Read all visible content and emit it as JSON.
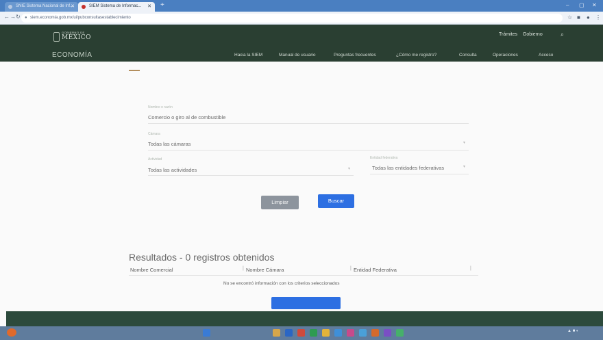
{
  "browser": {
    "tabs": [
      {
        "label": "SNIE Sistema Nacional de Inf...",
        "active": false
      },
      {
        "label": "SIEM Sistema de Informac...",
        "active": true
      }
    ],
    "url": "siem.economia.gob.mx/ui/pubconsultasestablecimiento",
    "new_tab_icon": "plus-icon",
    "window_controls": [
      "minimize-icon",
      "maximize-icon",
      "close-icon"
    ]
  },
  "header": {
    "logo_small": "GOBIERNO DE",
    "logo_big": "MÉXICO",
    "section": "ECONOMÍA",
    "top_links": [
      "Trámites",
      "Gobierno"
    ],
    "search_icon": "search-icon",
    "menu": [
      "Hacia la SIEM",
      "Manual de usuario",
      "Preguntas frecuentes",
      "¿Cómo me registro?",
      "Consulta",
      "Operaciones",
      "Acceso"
    ]
  },
  "form": {
    "field1": {
      "label": "Nombre o razón",
      "value": "Comercio o giro al de combustible"
    },
    "field2": {
      "label": "Cámara",
      "value": "Todas las cámaras"
    },
    "field3": {
      "label": "Actividad",
      "value": "Todas las actividades"
    },
    "field4": {
      "label": "Entidad federativa",
      "value": "Todas las entidades federativas"
    },
    "clear_label": "Limpiar",
    "search_label": "Buscar"
  },
  "results": {
    "title": "Resultados - 0 registros obtenidos",
    "columns": [
      "Nombre Comercial",
      "Nombre Cámara",
      "Entidad Federativa"
    ],
    "empty_message": "No se encontró información con los criterios seleccionados",
    "count": 0
  },
  "colors": {
    "header": "#2a3f32",
    "accent": "#b38e5d",
    "primary_button": "#2d6fe2",
    "secondary_button": "#8d949d",
    "footer": "#2c4a3c",
    "taskbar": "#5f7c9d"
  }
}
